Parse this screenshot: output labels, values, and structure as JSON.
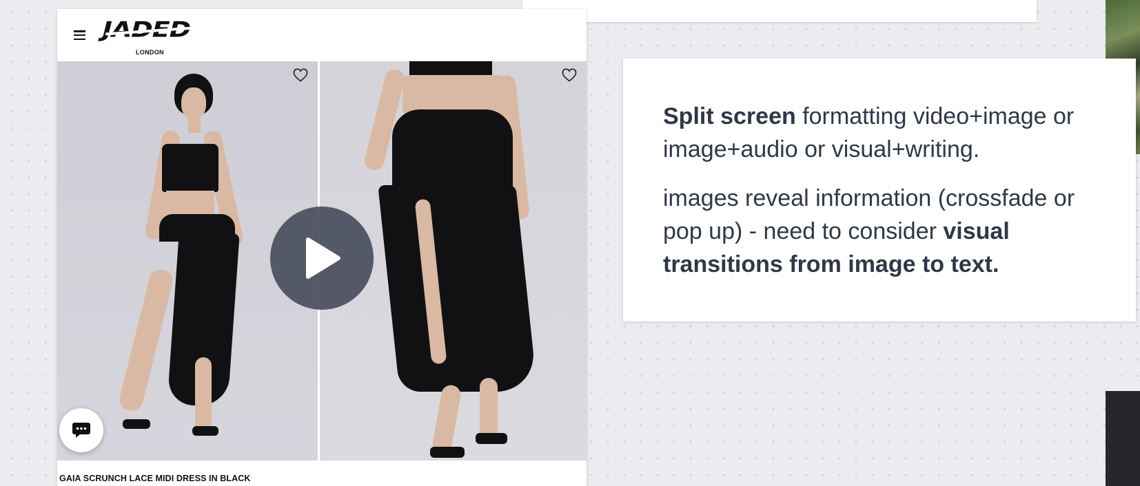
{
  "store": {
    "brand_name": "JADED",
    "brand_sub": "LONDON",
    "product_name": "GAIA SCRUNCH LACE MIDI DRESS IN BLACK",
    "icons": {
      "menu": "hamburger-menu-icon",
      "wishlist": "heart-icon",
      "play": "play-icon",
      "chat": "chat-bubble-icon"
    }
  },
  "notes": {
    "p1_bold": "Split screen",
    "p1_rest": " formatting video+image or image+audio or visual+writing.",
    "p2_text": "images reveal information (crossfade or pop up) - need to consider ",
    "p2_bold": "visual transitions from image to text."
  },
  "colors": {
    "canvas": "#ebecef",
    "note_text": "#2f3846",
    "play_button": "#4a505e"
  }
}
